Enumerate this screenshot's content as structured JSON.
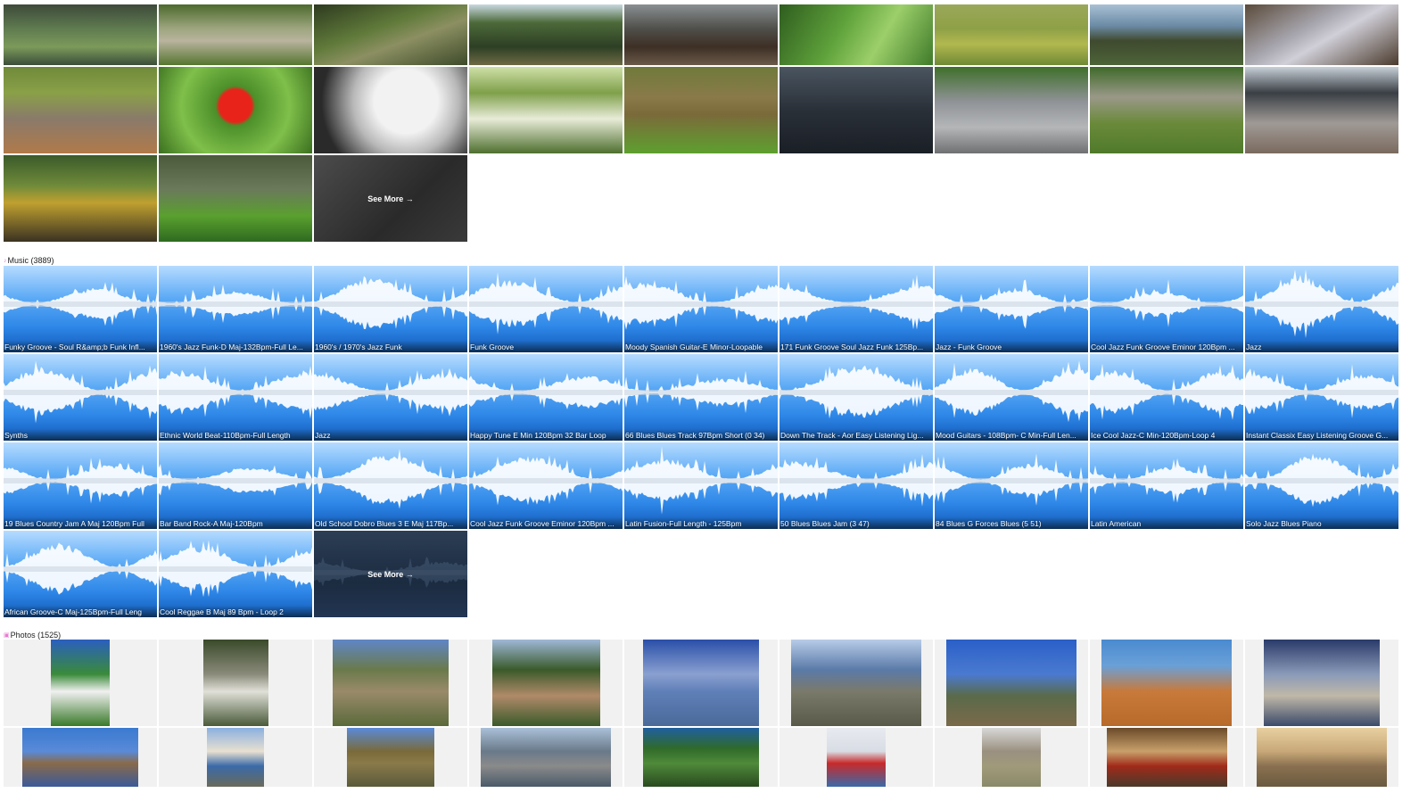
{
  "videos": {
    "tiles": [
      {
        "name": "canal-bridge",
        "bg": "linear-gradient(180deg,#3e4a3a 0%,#5f7b50 40%,#7c9a5a 70%,#3b4d3a 100%)"
      },
      {
        "name": "cyclist-path",
        "bg": "linear-gradient(180deg,#4d6a2e 0%,#9ea67f 40%,#b8b39e 60%,#56762f 100%)"
      },
      {
        "name": "lily-pads",
        "bg": "linear-gradient(160deg,#2d3a1f 0%,#607a3a 40%,#8c8f62 60%,#3d4a2a 100%)"
      },
      {
        "name": "forest-trees",
        "bg": "linear-gradient(180deg,#c8d8e0 0%,#4d6a3a 30%,#2d3f24 70%,#6e6a44 100%)"
      },
      {
        "name": "wooden-bridge",
        "bg": "linear-gradient(180deg,#8a8f92 0%,#4f4f4a 40%,#3e2f25 70%,#6a5a4a 100%)"
      },
      {
        "name": "green-leaves",
        "bg": "linear-gradient(120deg,#2f5d1f 0%,#5fa23b 40%,#9ccf6a 65%,#3f7a2a 100%)"
      },
      {
        "name": "riverside-walk",
        "bg": "linear-gradient(180deg,#9aa85a 0%,#8ea046 40%,#b2b84f 65%,#6f8a35 100%)"
      },
      {
        "name": "coastal-cliff",
        "bg": "linear-gradient(180deg,#a9c0d4 0%,#6b8ba6 35%,#3f4a2f 60%,#4c6438 100%)"
      },
      {
        "name": "frosty-grass",
        "bg": "linear-gradient(150deg,#5a4a3a 0%,#a8a7b0 40%,#d0cfd8 55%,#4a3a2c 100%)"
      },
      {
        "name": "village-rooftops",
        "bg": "linear-gradient(180deg,#6f8a3a 0%,#8aa048 30%,#8a7a6a 60%,#b07a4a 100%)",
        "tall": true
      },
      {
        "name": "red-tulip",
        "bg": "radial-gradient(circle at 50% 45%,#e8231a 0 18%,#4c8f2a 22%,#7fbf4a 60%,#3a6f1f 100%)",
        "tall": true
      },
      {
        "name": "bare-branches",
        "bg": "radial-gradient(circle at 60% 40%,#f2f2f2 0 30%,#b8b8b8 50%,#2a2a2a 80%)",
        "tall": true
      },
      {
        "name": "blossom-bush",
        "bg": "linear-gradient(180deg,#cfe0a8 0%,#7fa04a 30%,#e8ecd8 60%,#4f6f2f 100%)",
        "tall": true
      },
      {
        "name": "brown-river",
        "bg": "linear-gradient(180deg,#6f7a3a 0%,#8a7a4a 35%,#7a6a3a 55%,#5ea02f 100%)",
        "tall": true
      },
      {
        "name": "ducks-pond",
        "bg": "linear-gradient(180deg,#4a5560 0%,#2a3038 50%,#1a1f26 100%)",
        "tall": true
      },
      {
        "name": "car-bicycle",
        "bg": "linear-gradient(180deg,#3f6f2a 0%,#8f9296 40%,#b4b6b8 70%,#6e7072 100%)",
        "tall": true
      },
      {
        "name": "stone-ruins",
        "bg": "linear-gradient(180deg,#3f6a2a 0%,#9a9888 35%,#6a8a3a 65%,#4f7a2a 100%)",
        "tall": true
      },
      {
        "name": "train-platform",
        "bg": "linear-gradient(180deg,#c8d0d8 0%,#3a3f45 30%,#a09a96 65%,#7a6a5e 100%)",
        "tall": true
      },
      {
        "name": "canal-lock",
        "bg": "linear-gradient(180deg,#3a5a2a 0%,#6f8a3a 35%,#c0a030 55%,#3a3222 100%)",
        "tall": true
      },
      {
        "name": "grassy-bank",
        "bg": "linear-gradient(180deg,#4a5a3a 0%,#6a7a5a 40%,#5aa02f 70%,#2f6a1f 100%)",
        "tall": true
      }
    ],
    "see_more": "See More →"
  },
  "music": {
    "header": "Music (3889)",
    "tracks": [
      "Funky Groove - Soul R&amp;b Funk Infl...",
      "1960's Jazz Funk-D Maj-132Bpm-Full Le...",
      "1960's / 1970's Jazz Funk",
      "Funk Groove",
      "Moody Spanish Guitar-E Minor-Loopable",
      "171 Funk Groove Soul Jazz Funk 125Bp...",
      "Jazz - Funk Groove",
      "Cool Jazz Funk Groove Eminor 120Bpm ...",
      "Jazz",
      "Synths",
      "Ethnic World Beat-110Bpm-Full Length",
      "Jazz",
      "Happy Tune E Min 120Bpm 32 Bar Loop",
      "66 Blues Blues Track 97Bpm Short (0 34)",
      "Down The Track - Aor Easy Listening Lig...",
      "Mood Guitars - 108Bpm- C Min-Full Len...",
      "Ice Cool Jazz-C Min-120Bpm-Loop 4",
      "Instant Classix Easy Listening Groove G...",
      "19 Blues Country Jam A Maj 120Bpm Full",
      "Bar Band Rock-A Maj-120Bpm",
      "Old School Dobro Blues 3 E Maj 117Bp...",
      "Cool Jazz Funk Groove Eminor 120Bpm ...",
      "Latin Fusion-Full Length - 125Bpm",
      "50 Blues Blues Jam (3 47)",
      "84 Blues G Forces Blues (5 51)",
      "Latin American",
      "Solo Jazz Blues Piano",
      "African Groove-C Maj-125Bpm-Full Leng",
      "Cool Reggae B Maj 89 Bpm - Loop 2"
    ],
    "see_more": "See More →"
  },
  "photos": {
    "header": "Photos (1525)",
    "row1": [
      {
        "name": "palm-tree-house",
        "w": 66,
        "bg": "linear-gradient(180deg,#2a5fbf 0%,#3a8a3a 40%,#f0f0f0 60%,#3a7a2a 100%)"
      },
      {
        "name": "mountain-stream",
        "w": 73,
        "bg": "linear-gradient(180deg,#3a4a2a 0%,#8a8a7a 40%,#e0e0d8 60%,#4a5a3a 100%)"
      },
      {
        "name": "rocky-valley",
        "w": 130,
        "bg": "linear-gradient(180deg,#5f86c8 0%,#6a7a4a 35%,#9a8a6a 60%,#5a6a3a 100%)"
      },
      {
        "name": "chateau-village",
        "w": 121,
        "bg": "linear-gradient(180deg,#9fb8d8 0%,#3a5a2a 35%,#b08a6a 65%,#3a5a2a 100%)"
      },
      {
        "name": "sea-clouds",
        "w": 130,
        "bg": "linear-gradient(180deg,#2a4fa8 0%,#8aa0d0 40%,#5f7fb8 60%,#4a6a9a 100%)"
      },
      {
        "name": "rocky-coast",
        "w": 146,
        "bg": "linear-gradient(180deg,#b8cce8 0%,#5a7aa8 35%,#7a7a6a 60%,#5a5a4a 100%)"
      },
      {
        "name": "coast-house",
        "w": 146,
        "bg": "linear-gradient(180deg,#2a5fc8 0%,#4a7ad0 40%,#5a6a4a 65%,#7a6a4a 100%)"
      },
      {
        "name": "red-rocks",
        "w": 146,
        "bg": "linear-gradient(180deg,#4a8ad0 0%,#6aa0d8 30%,#c87a3a 60%,#b86a2a 100%)"
      },
      {
        "name": "harbor-boats",
        "w": 130,
        "bg": "linear-gradient(180deg,#2a3a6a 0%,#8a9ab8 40%,#c0b8a8 65%,#3a4a6a 100%)"
      }
    ],
    "row2": [
      {
        "name": "island-rocks",
        "w": 130,
        "bg": "linear-gradient(180deg,#3a7ad0 0%,#5a8ad8 40%,#8a6a4a 60%,#3a5a9a 100%)"
      },
      {
        "name": "blue-house",
        "w": 64,
        "bg": "linear-gradient(180deg,#8ab0e0 0%,#e8e0d0 40%,#3a6aa8 65%,#6a6a5a 100%)"
      },
      {
        "name": "grassy-shore",
        "w": 98,
        "bg": "linear-gradient(180deg,#5a8ad8 0%,#7a6a3a 40%,#8a7a4a 60%,#5a5a3a 100%)"
      },
      {
        "name": "marina-flags",
        "w": 146,
        "bg": "linear-gradient(180deg,#aac0d8 0%,#6a7a8a 40%,#8a8a8a 65%,#4a5a6a 100%)"
      },
      {
        "name": "green-field",
        "w": 130,
        "bg": "linear-gradient(180deg,#1f5f9f 0%,#2f6a2a 35%,#4f8a3a 60%,#2a4a1f 100%)"
      },
      {
        "name": "sailboat",
        "w": 66,
        "bg": "linear-gradient(180deg,#e8eaf0 0%,#d8dce4 40%,#c82a2a 60%,#3a6aa8 100%)"
      },
      {
        "name": "cathedral-field",
        "w": 66,
        "bg": "linear-gradient(180deg,#d8d8d8 0%,#9a9080 40%,#a09a7a 65%,#8a8a6a 100%)"
      },
      {
        "name": "hotel-terrace",
        "w": 135,
        "bg": "linear-gradient(180deg,#6a4a2a 0%,#c8a06a 40%,#a02a1a 65%,#4a3a2a 100%)"
      },
      {
        "name": "sunset-hills",
        "w": 146,
        "bg": "linear-gradient(180deg,#e8d0a0 0%,#c8a878 40%,#8a7050 65%,#6a5a40 100%)"
      }
    ]
  }
}
